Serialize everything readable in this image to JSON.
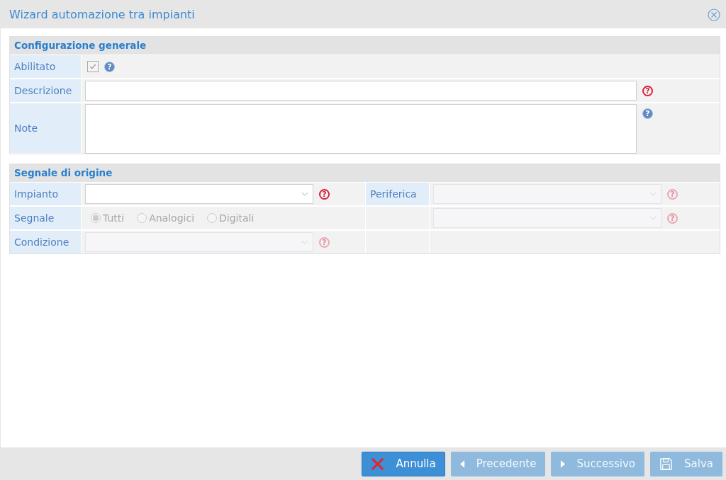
{
  "window": {
    "title": "Wizard automazione tra impianti"
  },
  "general": {
    "title": "Configurazione generale",
    "enabled": {
      "label": "Abilitato",
      "checked": true,
      "disabled": true,
      "help": {
        "kind": "info",
        "text": "?"
      }
    },
    "description": {
      "label": "Descrizione",
      "help": {
        "kind": "required",
        "text": "?"
      }
    },
    "note": {
      "label": "Note",
      "help": {
        "kind": "info",
        "text": "?"
      }
    }
  },
  "source": {
    "title": "Segnale di origine",
    "plant": {
      "label": "Impianto",
      "disabled": false,
      "help": {
        "kind": "required",
        "text": "?"
      }
    },
    "device": {
      "label": "Periferica",
      "disabled": true,
      "help": {
        "kind": "required",
        "text": "?"
      }
    },
    "signal": {
      "label": "Segnale",
      "disabled": true,
      "options": [
        {
          "label": "Tutti",
          "selected": true
        },
        {
          "label": "Analogici",
          "selected": false
        },
        {
          "label": "Digitali",
          "selected": false
        }
      ]
    },
    "signal_select": {
      "disabled": true,
      "help": {
        "kind": "required",
        "text": "?"
      }
    },
    "condition": {
      "label": "Condizione",
      "disabled": true,
      "help": {
        "kind": "required",
        "text": "?"
      }
    }
  },
  "buttons": [
    {
      "label": "Annulla",
      "kind": "cancel",
      "disabled": false
    },
    {
      "label": "Precedente",
      "kind": "prev",
      "disabled": true
    },
    {
      "label": "Successivo",
      "kind": "next",
      "disabled": true
    },
    {
      "label": "Salva",
      "kind": "save",
      "disabled": true
    }
  ]
}
